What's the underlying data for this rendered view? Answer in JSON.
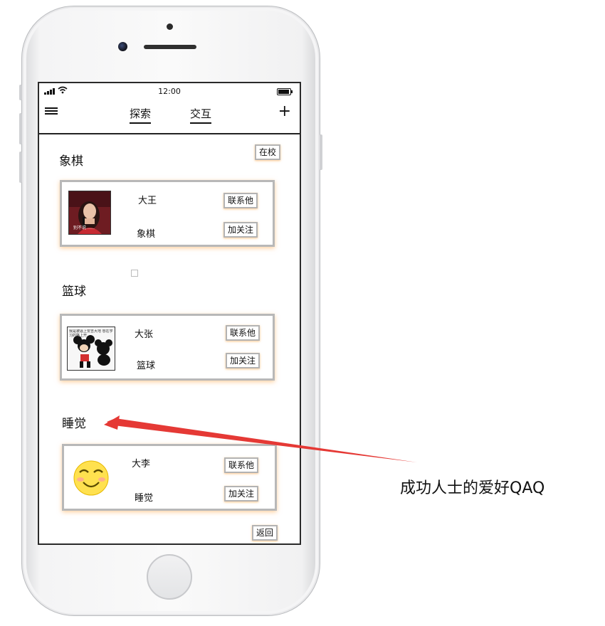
{
  "status": {
    "time": "12:00"
  },
  "nav": {
    "tab_explore": "探索",
    "tab_interact": "交互",
    "add_symbol": "+"
  },
  "campus_button": "在校",
  "back_button": "返回",
  "sections": [
    {
      "title": "象棋",
      "name": "大王",
      "tag": "象棋",
      "contact": "联系他",
      "follow": "加关注"
    },
    {
      "title": "篮球",
      "name": "大张",
      "tag": "篮球",
      "contact": "联系他",
      "follow": "加关注"
    },
    {
      "title": "睡觉",
      "name": "大李",
      "tag": "睡觉",
      "contact": "联系他",
      "follow": "加关注"
    }
  ],
  "avatar_captions": {
    "first": "别不说……",
    "second": "我是被逼上安吉大地 想在学习的路上开"
  },
  "annotation": "成功人士的爱好QAQ",
  "colors": {
    "annotation_arrow": "#e53935",
    "card_border": "#b8b8b8",
    "button_glow": "#ffaa50"
  }
}
